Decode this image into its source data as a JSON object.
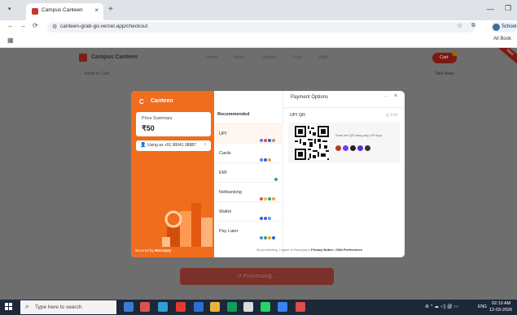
{
  "browser": {
    "tab_title": "Campus Canteen",
    "tab_close": "×",
    "new_tab": "+",
    "tab_menu": "▾",
    "url": "canteen-grab-go.vercel.app/checkout",
    "profile_name": "School",
    "all_bookmarks": "All Book",
    "back": "←",
    "forward": "→",
    "reload": "⟳",
    "site_info": "⚙",
    "zoom": "🔍",
    "star": "☆",
    "extensions": "⧉",
    "minimize": "—",
    "restore": "❐"
  },
  "page": {
    "brand": "Campus Canteen",
    "nav": [
      "Home",
      "Menu",
      "Orders",
      "Track",
      "Staff"
    ],
    "cart_label": "Cart",
    "ribbon": "New",
    "take_away": "Take Away",
    "back_link": "← Back to Cart",
    "processing": "⟳  Processing..."
  },
  "modal": {
    "merchant_logo": "C",
    "merchant_name": "Canteen",
    "price_label": "Price Summary",
    "price_value": "₹50",
    "user_text": "Using as +91 90041 38887",
    "user_chevron": "›",
    "secured_by": "Secured by",
    "secured_brand": "Razorpay",
    "title": "Payment Options",
    "dots": "···",
    "close": "×",
    "recommended": "Recommended",
    "methods": [
      {
        "label": "UPI",
        "colors": [
          "#5b7ce6",
          "#e84a4a",
          "#2b5fd9",
          "#999999"
        ]
      },
      {
        "label": "Cards",
        "colors": [
          "#5b7ce6",
          "#2b5fd9",
          "#e8a33a"
        ]
      },
      {
        "label": "EMI",
        "colors": [
          "#3aa65b"
        ]
      },
      {
        "label": "Netbanking",
        "colors": [
          "#e84a4a",
          "#e8c33a",
          "#3aa65b",
          "#e8a33a"
        ]
      },
      {
        "label": "Wallet",
        "colors": [
          "#2b5fd9",
          "#7a3ae8",
          "#3aa6e8"
        ]
      },
      {
        "label": "Pay Later",
        "colors": [
          "#5b7ce6",
          "#3aa65b",
          "#e8a33a",
          "#2b5fd9"
        ]
      }
    ],
    "upi_qr_label": "UPI QR",
    "edit_label": "⎙ Edit",
    "qr_hint": "Scan the QR using any UPI App",
    "upi_apps": [
      "#c0392b",
      "#7a3ae8",
      "#222222",
      "#5b2bd9",
      "#333333"
    ],
    "consent": "By proceeding, I agree to Razorpay's",
    "consent_link": "Privacy Notice • Edit Preferences"
  },
  "taskbar": {
    "search_placeholder": "Type here to search",
    "time": "02:10 AM",
    "date": "12-03-2026",
    "lang": "ENG",
    "tray": "⊕ ^ ☁ ◁) ∰ ▭"
  }
}
